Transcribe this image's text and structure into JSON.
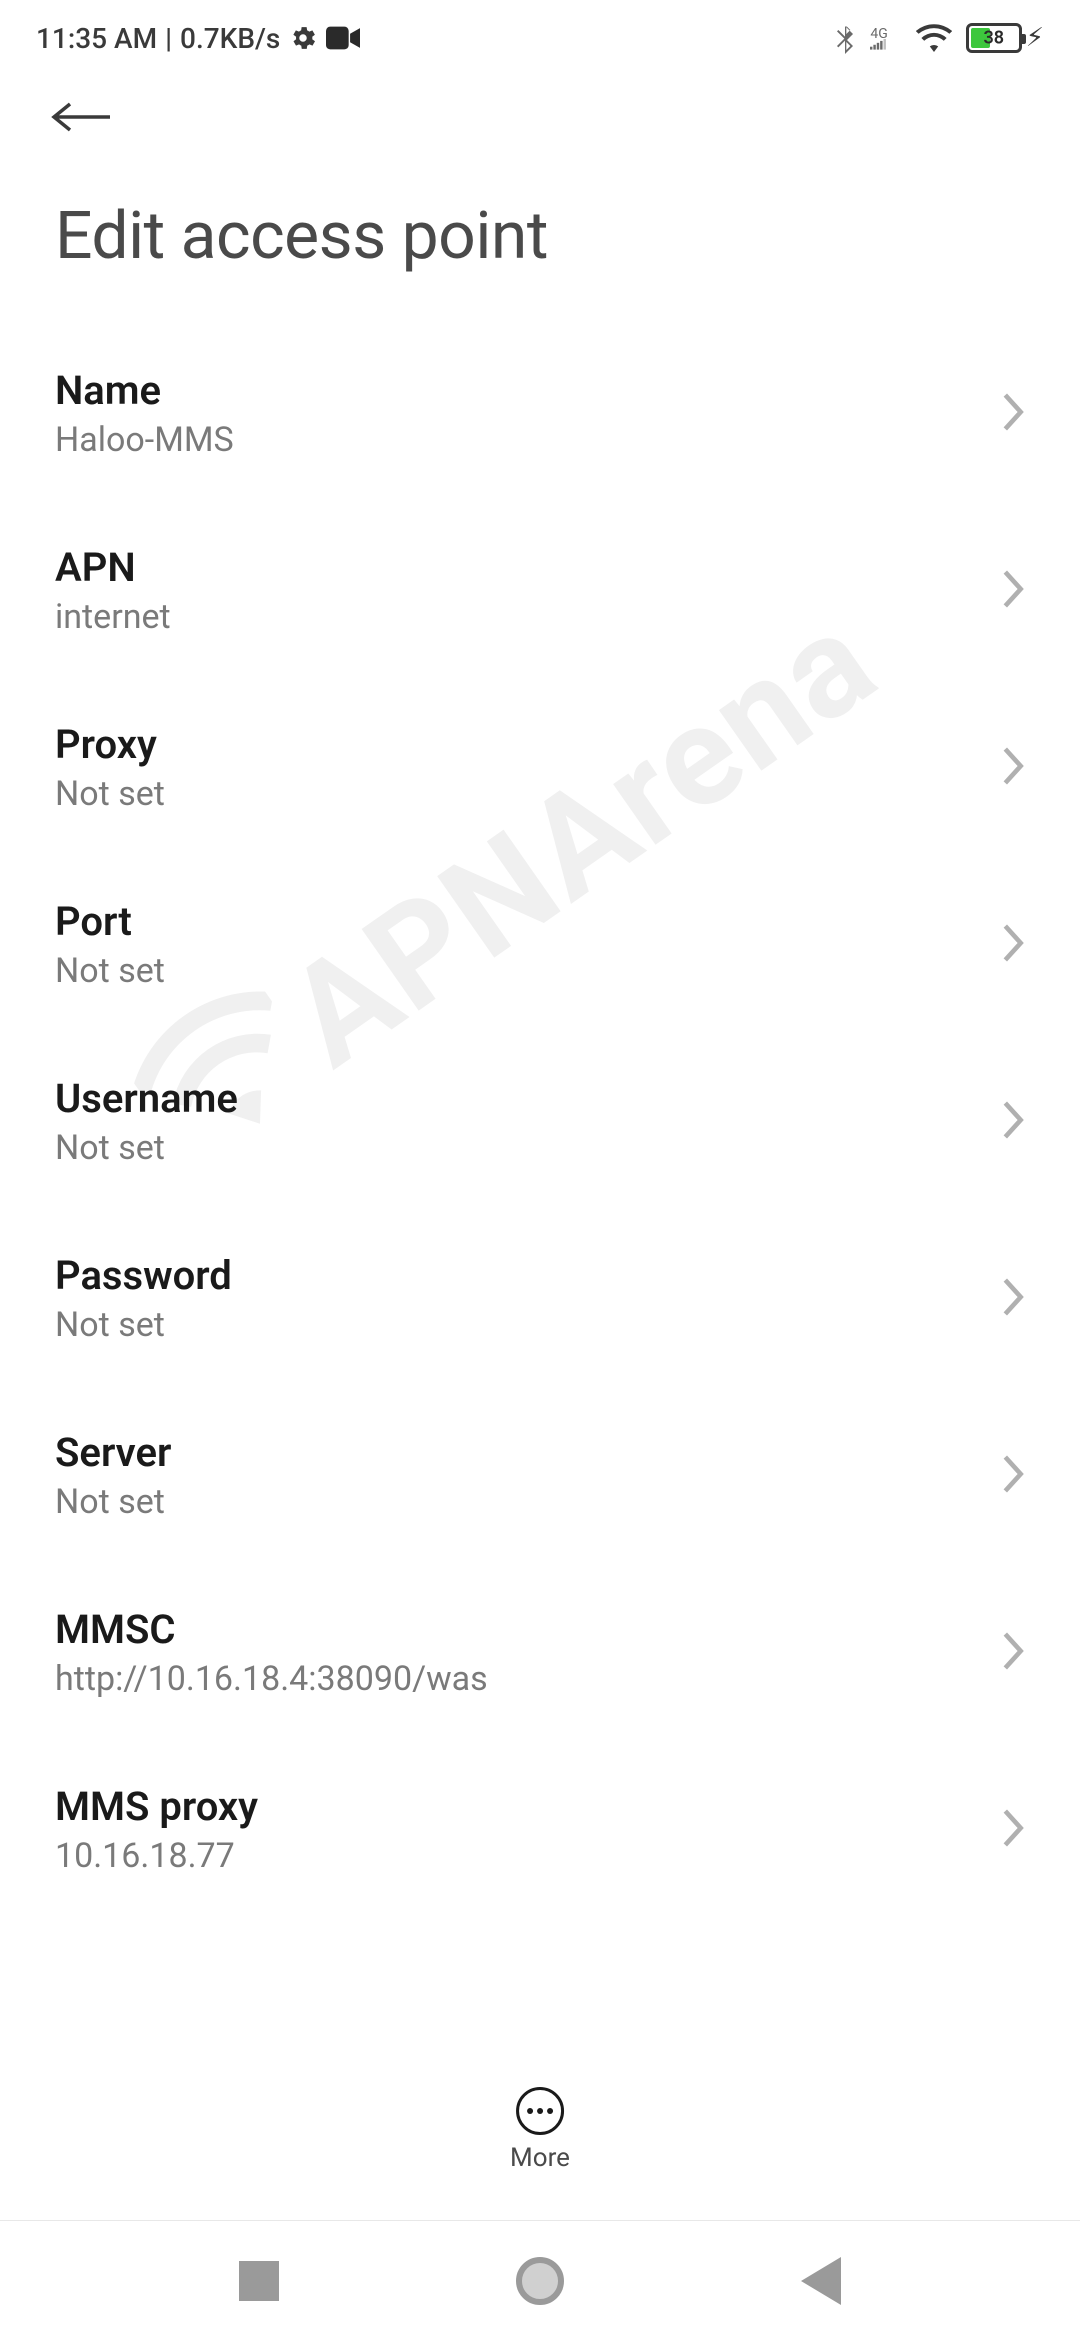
{
  "status": {
    "time": "11:35 AM",
    "speed": "0.7KB/s",
    "network_label": "4G",
    "battery_pct": "38"
  },
  "header": {
    "title": "Edit access point"
  },
  "settings": [
    {
      "label": "Name",
      "value": "Haloo-MMS"
    },
    {
      "label": "APN",
      "value": "internet"
    },
    {
      "label": "Proxy",
      "value": "Not set"
    },
    {
      "label": "Port",
      "value": "Not set"
    },
    {
      "label": "Username",
      "value": "Not set"
    },
    {
      "label": "Password",
      "value": "Not set"
    },
    {
      "label": "Server",
      "value": "Not set"
    },
    {
      "label": "MMSC",
      "value": "http://10.16.18.4:38090/was"
    },
    {
      "label": "MMS proxy",
      "value": "10.16.18.77"
    }
  ],
  "footer": {
    "more_label": "More"
  },
  "watermark": {
    "text": "APNArena"
  }
}
